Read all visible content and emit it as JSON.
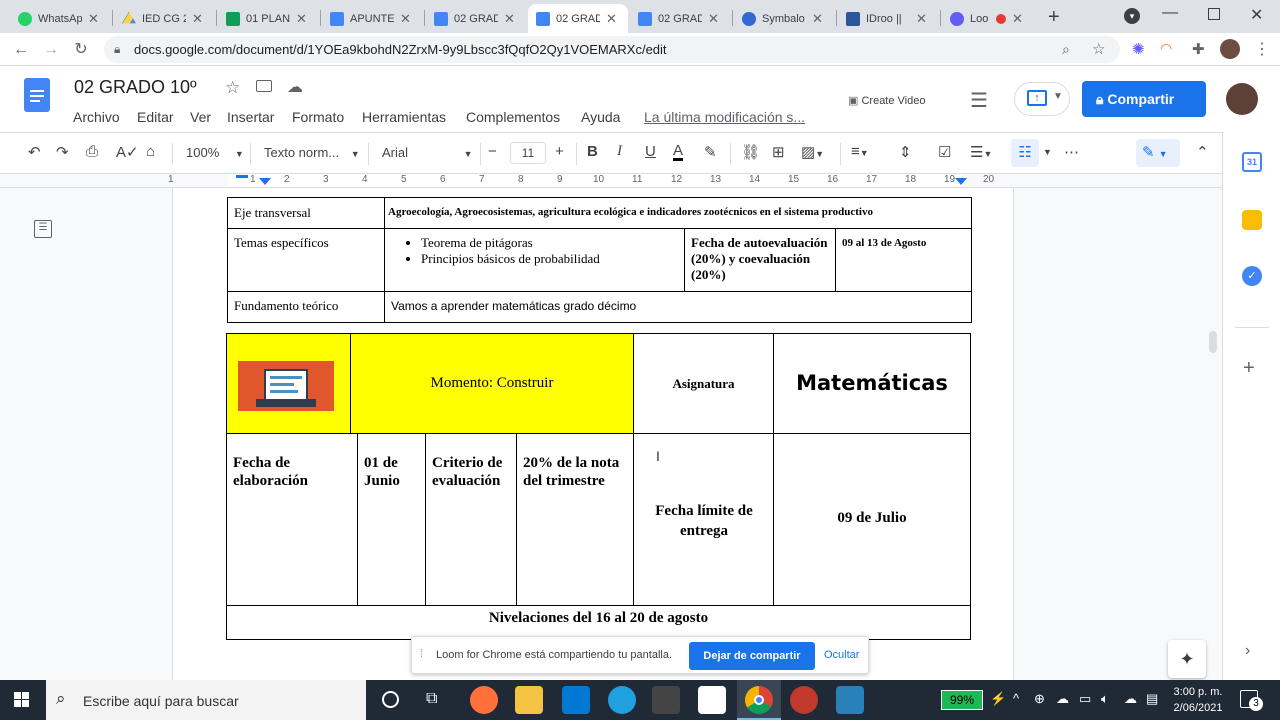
{
  "browser": {
    "tabs": [
      {
        "label": "WhatsAp",
        "color": "#25d366"
      },
      {
        "label": "IED CG 2",
        "color": "#1fa463"
      },
      {
        "label": "01 PLAN",
        "color": "#0f9d58"
      },
      {
        "label": "APUNTE",
        "color": "#4285f4"
      },
      {
        "label": "02 GRAD",
        "color": "#4285f4"
      },
      {
        "label": "02 GRAD",
        "color": "#4285f4"
      },
      {
        "label": "02 GRAD",
        "color": "#4285f4"
      },
      {
        "label": "Symbalo",
        "color": "#3367d6"
      },
      {
        "label": "IDroo ||",
        "color": "#2b579a"
      },
      {
        "label": "Loo",
        "color": "#625df5"
      }
    ],
    "url": "docs.google.com/document/d/1YOEa9kbohdN2ZrxM-9y9Lbscc3fQqfO2Qy1VOEMARXc/edit"
  },
  "docs": {
    "title": "02 GRADO 10º",
    "menu": [
      "Archivo",
      "Editar",
      "Ver",
      "Insertar",
      "Formato",
      "Herramientas",
      "Complementos",
      "Ayuda"
    ],
    "last_edit": "La última modificación s...",
    "create_video": "Create Video",
    "share_label": "Compartir",
    "toolbar": {
      "zoom": "100%",
      "style": "Texto norm...",
      "font": "Arial",
      "size": "11"
    },
    "ruler_numbers": [
      "1",
      "1",
      "2",
      "3",
      "4",
      "5",
      "6",
      "7",
      "8",
      "9",
      "10",
      "11",
      "12",
      "13",
      "14",
      "15",
      "16",
      "17",
      "18",
      "19",
      "20"
    ]
  },
  "table1": {
    "eje_label": "Eje transversal",
    "eje_value": "Agroecología, Agroecosistemas, agricultura ecológica e indicadores zootécnicos en el sistema productivo",
    "temas_label": "Temas específicos",
    "temas_items": [
      "Teorema de pitágoras",
      "Principios básicos de probabilidad"
    ],
    "fecha_auto_label": "Fecha de autoevaluación (20%) y coevaluación (20%)",
    "fecha_auto_value": "09 al 13 de Agosto",
    "fundamento_label": "Fundamento teórico",
    "fundamento_value": "Vamos a aprender matemáticas grado décimo"
  },
  "table2": {
    "momento": "Momento: Construir",
    "asignatura_label": "Asignatura",
    "asignatura_value": "Matemáticas",
    "fecha_elab_label": "Fecha de elaboración",
    "fecha_elab_value": "01 de Junio",
    "criterio_label": "Criterio de evaluación",
    "criterio_value": "20% de la nota del trimestre",
    "fecha_limite_label": "Fecha límite de entrega",
    "fecha_limite_value": "09 de Julio",
    "nivelaciones": "Nivelaciones del 16 al 20 de agosto"
  },
  "loom_banner": {
    "message": "Loom for Chrome está compartiendo tu pantalla.",
    "stop_button": "Dejar de compartir",
    "hide_button": "Ocultar"
  },
  "taskbar": {
    "search_placeholder": "Escribe aquí para buscar",
    "battery": "99%",
    "time": "3:00 p. m.",
    "date": "2/06/2021",
    "notifications": "3"
  }
}
